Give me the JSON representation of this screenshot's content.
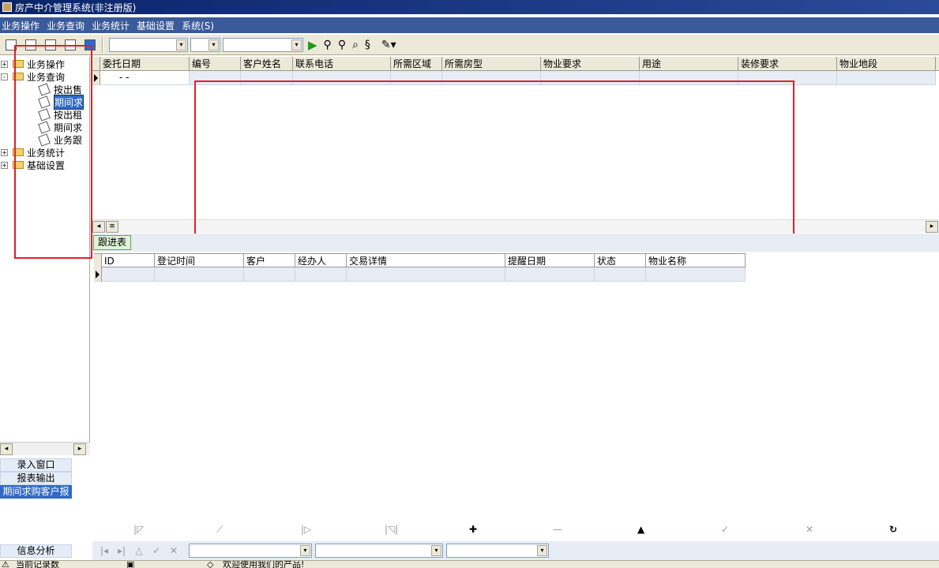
{
  "window": {
    "title": "房产中介管理系统(非注册版)"
  },
  "menu": [
    "业务操作",
    "业务查询",
    "业务统计",
    "基础设置",
    "系统(S)"
  ],
  "toolbar": {
    "icons": [
      "new-icon",
      "list-icon",
      "doc-icon",
      "form-icon",
      "window-icon"
    ],
    "search_tools": [
      "find-icon",
      "find-next-icon",
      "preview-icon",
      "refresh-icon",
      "edit-icon"
    ]
  },
  "tree": {
    "nodes": [
      {
        "label": "业务操作",
        "level": 0,
        "expander": "+"
      },
      {
        "label": "业务查询",
        "level": 0,
        "expander": "-"
      },
      {
        "label": "按出售",
        "level": 1
      },
      {
        "label": "期间求",
        "level": 1,
        "selected": true
      },
      {
        "label": "按出租",
        "level": 1
      },
      {
        "label": "期间求",
        "level": 1
      },
      {
        "label": "业务跟",
        "level": 1
      },
      {
        "label": "业务统计",
        "level": 0,
        "expander": "+"
      },
      {
        "label": "基础设置",
        "level": 0,
        "expander": "+"
      }
    ]
  },
  "left_buttons": [
    "录入窗口",
    "报表输出",
    "期间求购客户报表"
  ],
  "left_bottom_button": "信息分析",
  "top_grid": {
    "columns": [
      "委托日期",
      "编号",
      "客户姓名",
      "联系电话",
      "所需区域",
      "所需房型",
      "物业要求",
      "用途",
      "装修要求",
      "物业地段"
    ],
    "first_row": [
      "-  -"
    ]
  },
  "tab": {
    "label": "跟进表"
  },
  "bottom_grid": {
    "columns": [
      "ID",
      "登记时间",
      "客户",
      "经办人",
      "交易详情",
      "提醒日期",
      "状态",
      "物业名称"
    ]
  },
  "status": {
    "left": "当前记录数",
    "right": "欢迎使用我们的产品!"
  }
}
